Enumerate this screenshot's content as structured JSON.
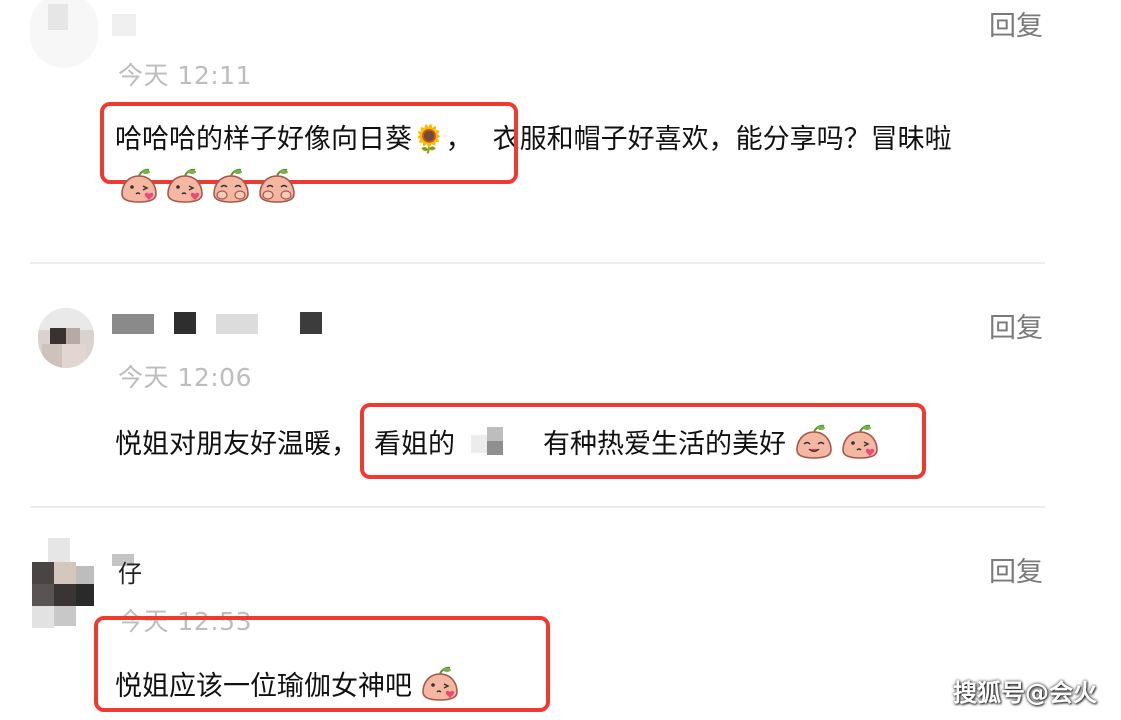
{
  "comments": [
    {
      "timestamp": "今天 12:11",
      "reply_label": "回复",
      "text_highlighted": "哈哈哈的样子好像向日葵🌻，",
      "text_rest": "衣服和帽子好喜欢，能分享吗？冒昧啦",
      "emoji_icons": [
        "peach-kiss-emoji",
        "peach-kiss-emoji",
        "peach-shy-emoji",
        "peach-shy-emoji"
      ]
    },
    {
      "timestamp": "今天 12:06",
      "reply_label": "回复",
      "text_prefix": "悦姐对朋友好温暖，",
      "text_highlight_a": "看姐的",
      "text_highlight_b": "有种热爱生活的美好",
      "emoji_icons": [
        "peach-smile-emoji",
        "peach-kiss-emoji"
      ]
    },
    {
      "username": "仔",
      "timestamp": "今天 12:53",
      "reply_label": "回复",
      "text_highlighted": "悦姐应该一位瑜伽女神吧",
      "emoji_icons": [
        "peach-kiss-emoji"
      ]
    }
  ],
  "watermark": "搜狐号@会火",
  "colors": {
    "highlight_border": "#ef3a2f",
    "timestamp": "#bdbdbd",
    "reply": "#7a7a7a",
    "divider": "#ececec"
  }
}
